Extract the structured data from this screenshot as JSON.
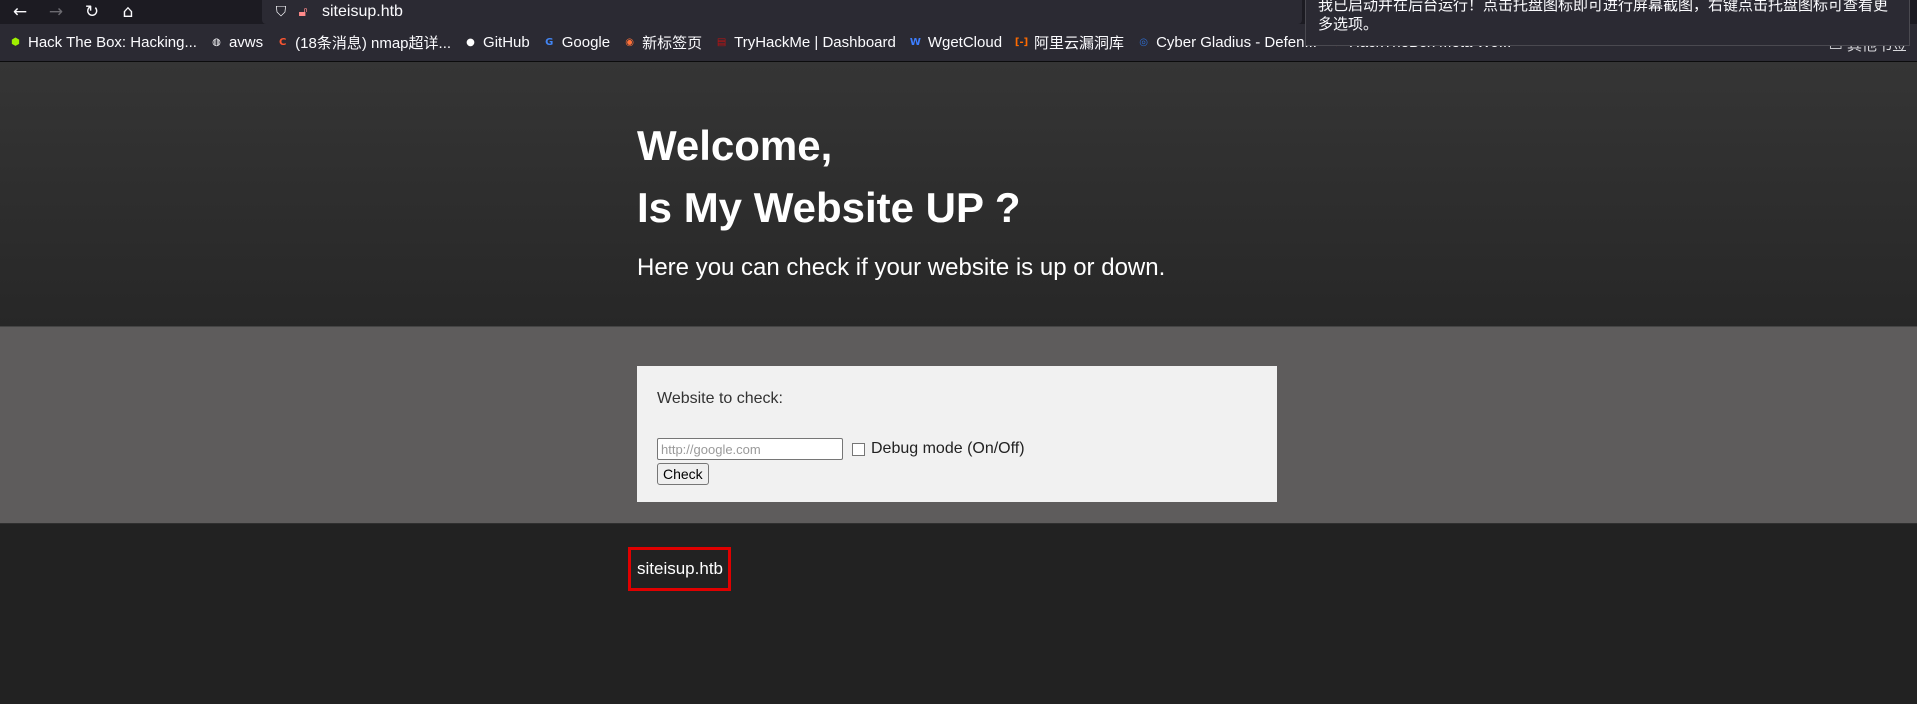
{
  "browser": {
    "url": "siteisup.htb",
    "bookmarks": [
      {
        "label": "Hack The Box: Hacking...",
        "icon": "htb-cube-icon",
        "color": "#9fef00"
      },
      {
        "label": "avws",
        "icon": "globe-icon",
        "color": "#fbfbfe"
      },
      {
        "label": "(18条消息) nmap超详...",
        "icon": "csdn-icon",
        "color": "#fc5531"
      },
      {
        "label": "GitHub",
        "icon": "github-icon",
        "color": "#ffffff"
      },
      {
        "label": "Google",
        "icon": "google-icon",
        "color": "#4285f4"
      },
      {
        "label": "新标签页",
        "icon": "firefox-icon",
        "color": "#ff7139"
      },
      {
        "label": "TryHackMe | Dashboard",
        "icon": "tryhackme-icon",
        "color": "#c11111"
      },
      {
        "label": "WgetCloud",
        "icon": "wgetcloud-icon",
        "color": "#3d7eff"
      },
      {
        "label": "阿里云漏洞库",
        "icon": "aliyun-icon",
        "color": "#ff6a00"
      },
      {
        "label": "Cyber Gladius - Defen...",
        "icon": "cyber-gladius-icon",
        "color": "#2d6fd6"
      },
      {
        "label": "HackTheBox Meta Wo...",
        "icon": "htb-meta-icon",
        "color": "#e0402b"
      }
    ],
    "other_bookmarks": "其他书签",
    "notification": "我已启动并在后台运行！点击托盘图标即可进行屏幕截图，右键点击托盘图标可查看更多选项。"
  },
  "page": {
    "heading_line1": "Welcome,",
    "heading_line2": "Is My Website UP ?",
    "subtitle": "Here you can check if your website is up or down.",
    "form": {
      "label": "Website to check:",
      "input_placeholder": "http://google.com",
      "input_value": "",
      "debug_label": "Debug mode (On/Off)",
      "debug_checked": false,
      "submit_label": "Check"
    },
    "footer_text": "siteisup.htb",
    "highlight_color": "#e00000"
  }
}
